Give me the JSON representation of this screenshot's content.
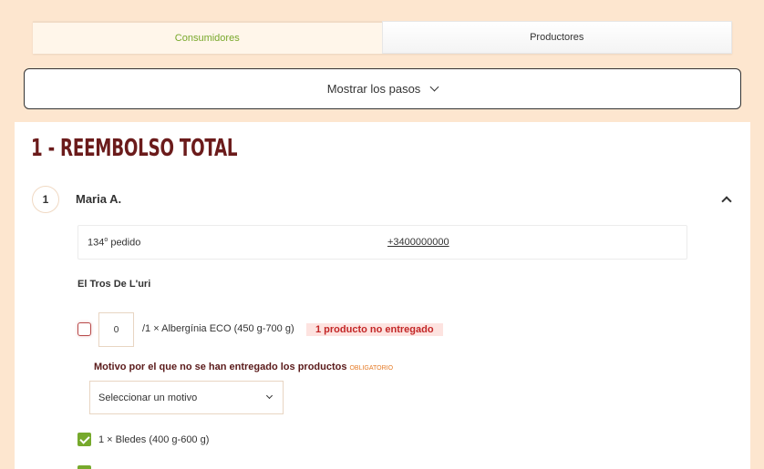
{
  "tabs": [
    {
      "label": "Consumidores",
      "active": true
    },
    {
      "label": "Productores",
      "active": false
    }
  ],
  "show_steps": {
    "label": "Mostrar los pasos"
  },
  "section": {
    "title": "1 - REEMBOLSO TOTAL"
  },
  "customer": {
    "step_number": "1",
    "name": "Maria A.",
    "order_number": "134",
    "order_number_suffix": "o",
    "order_label": " pedido",
    "phone": "+3400000000"
  },
  "producer": {
    "name": "El Tros De L'uri"
  },
  "undelivered_item": {
    "quantity": "0",
    "line": "/1 × Albergínia ECO (450 g-700 g)",
    "badge": "1 producto no entregado"
  },
  "reason": {
    "label": "Motivo por el que no se han entregado los productos",
    "required": "OBLIGATORIO",
    "select_placeholder": "Seleccionar un motivo"
  },
  "delivered_items": [
    {
      "label": "1 × Bledes (400 g-600 g)",
      "checked": true
    },
    {
      "label": "",
      "checked": true
    }
  ],
  "colors": {
    "background": "#fde6cf",
    "accent_green": "#76a92c",
    "title_red": "#6b1b1b",
    "alert_red": "#c32626",
    "required_orange": "#e57a25"
  }
}
